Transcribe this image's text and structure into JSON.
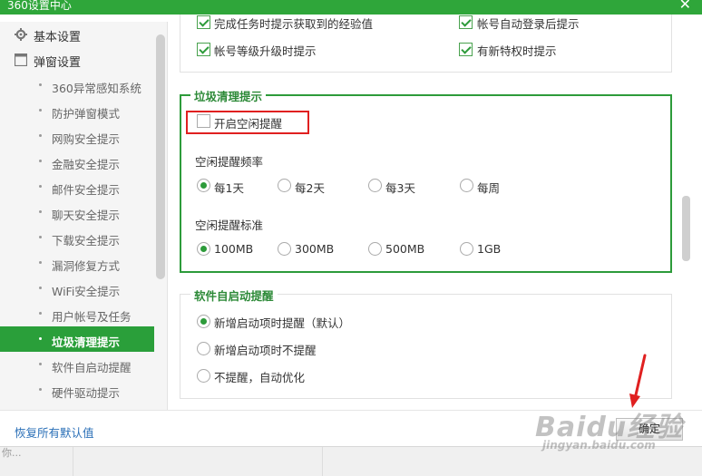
{
  "window": {
    "title": "360设置中心",
    "close_icon": "close-icon"
  },
  "sidebar": {
    "main_items": [
      {
        "label": "基本设置",
        "icon": "gear-icon"
      },
      {
        "label": "弹窗设置",
        "icon": "window-icon"
      }
    ],
    "sub_items": [
      {
        "label": "360异常感知系统"
      },
      {
        "label": "防护弹窗模式"
      },
      {
        "label": "网购安全提示"
      },
      {
        "label": "金融安全提示"
      },
      {
        "label": "邮件安全提示"
      },
      {
        "label": "聊天安全提示"
      },
      {
        "label": "下载安全提示"
      },
      {
        "label": "漏洞修复方式"
      },
      {
        "label": "WiFi安全提示"
      },
      {
        "label": "用户帐号及任务"
      },
      {
        "label": "垃圾清理提示",
        "active": true
      },
      {
        "label": "软件自启动提醒"
      },
      {
        "label": "硬件驱动提示"
      }
    ]
  },
  "top_group": {
    "options": [
      {
        "label": "完成任务时提示获取到的经验值",
        "checked": true
      },
      {
        "label": "帐号自动登录后提示",
        "checked": true
      },
      {
        "label": "帐号等级升级时提示",
        "checked": true
      },
      {
        "label": "有新特权时提示",
        "checked": true
      }
    ]
  },
  "junk_group": {
    "title": "垃圾清理提示",
    "enable_idle": {
      "label": "开启空闲提醒",
      "checked": false
    },
    "frequency": {
      "label": "空闲提醒频率",
      "options": [
        "每1天",
        "每2天",
        "每3天",
        "每周"
      ],
      "selected": "每1天"
    },
    "threshold": {
      "label": "空闲提醒标准",
      "options": [
        "100MB",
        "300MB",
        "500MB",
        "1GB"
      ],
      "selected": "100MB"
    }
  },
  "startup_group": {
    "title": "软件自启动提醒",
    "options": [
      "新增启动项时提醒（默认）",
      "新增启动项时不提醒",
      "不提醒，自动优化"
    ],
    "selected": "新增启动项时提醒（默认）"
  },
  "footer": {
    "restore_label": "恢复所有默认值",
    "confirm_label": "确定"
  },
  "background": {
    "partial_text": "你..."
  },
  "watermark": {
    "brand": "Baidu经验",
    "url": "jingyan.baidu.com"
  },
  "colors": {
    "accent": "#2fa63a",
    "highlight": "#e02020",
    "link": "#2a6fb7"
  }
}
